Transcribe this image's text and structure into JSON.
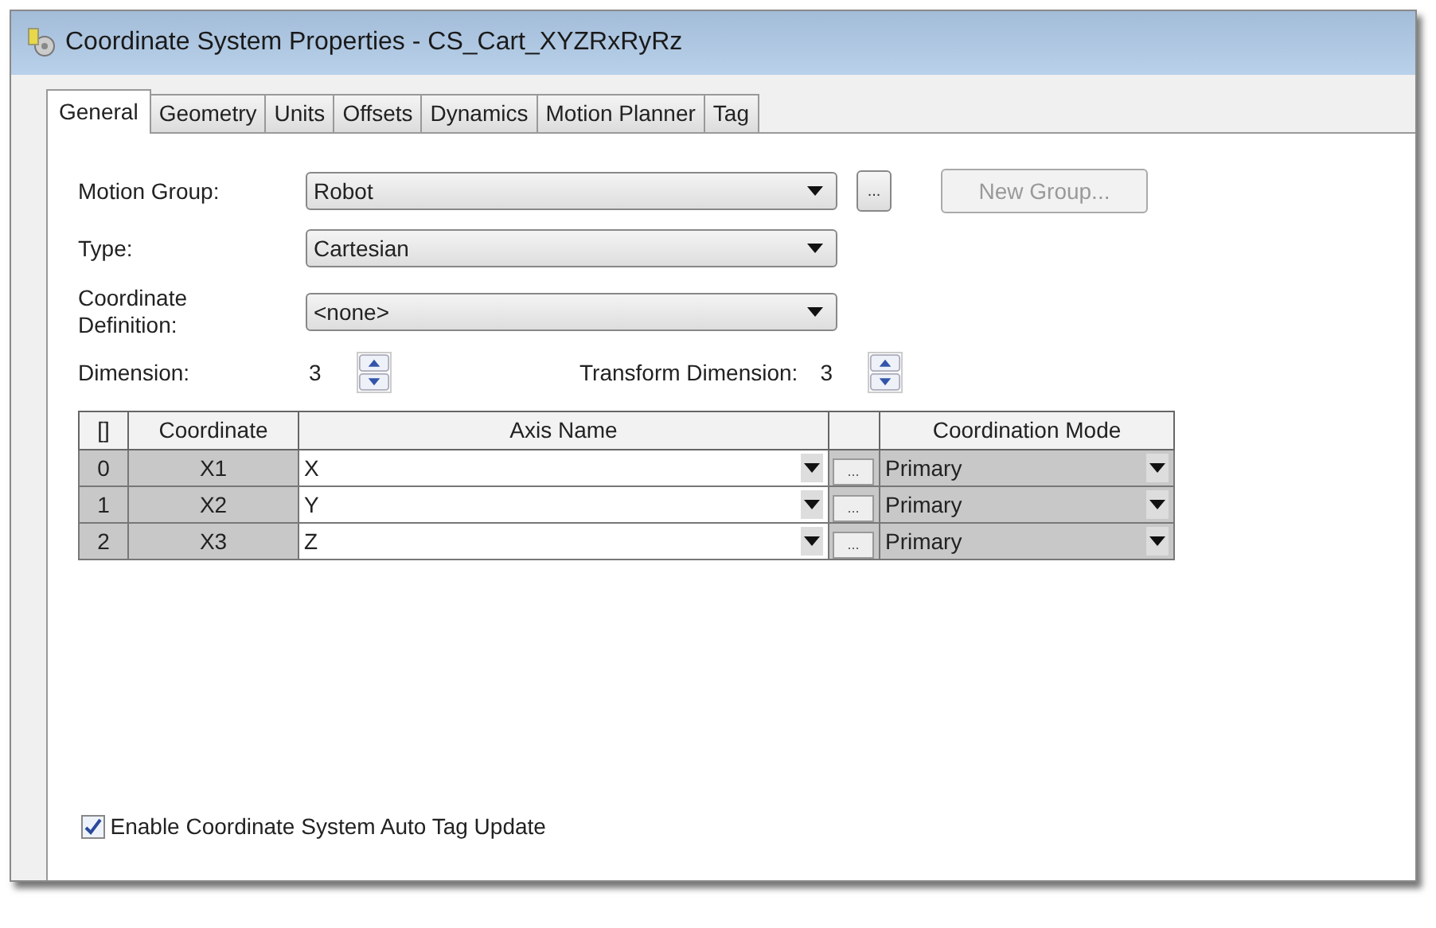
{
  "window": {
    "title": "Coordinate System Properties - CS_Cart_XYZRxRyRz"
  },
  "tabs": [
    {
      "label": "General",
      "selected": true
    },
    {
      "label": "Geometry",
      "selected": false
    },
    {
      "label": "Units",
      "selected": false
    },
    {
      "label": "Offsets",
      "selected": false
    },
    {
      "label": "Dynamics",
      "selected": false
    },
    {
      "label": "Motion Planner",
      "selected": false
    },
    {
      "label": "Tag",
      "selected": false
    }
  ],
  "motion_group": {
    "label": "Motion Group:",
    "value": "Robot",
    "browse_button": "...",
    "new_group_button": {
      "label": "New Group...",
      "disabled": true
    }
  },
  "type": {
    "label": "Type:",
    "value": "Cartesian"
  },
  "coordinate_definition": {
    "label": "Coordinate Definition:",
    "value": "<none>"
  },
  "dimension": {
    "label": "Dimension:",
    "value": "3"
  },
  "transform_dimension": {
    "label": "Transform Dimension:",
    "value": "3"
  },
  "table": {
    "columns": [
      "[]",
      "Coordinate",
      "Axis Name",
      "Coordination Mode"
    ],
    "rows": [
      {
        "index": "0",
        "coordinate": "X1",
        "axis_name": "X",
        "browse": "...",
        "coordination_mode": "Primary"
      },
      {
        "index": "1",
        "coordinate": "X2",
        "axis_name": "Y",
        "browse": "...",
        "coordination_mode": "Primary"
      },
      {
        "index": "2",
        "coordinate": "X3",
        "axis_name": "Z",
        "browse": "...",
        "coordination_mode": "Primary"
      }
    ]
  },
  "auto_tag_update": {
    "label": "Enable Coordinate System Auto Tag Update",
    "checked": true
  }
}
